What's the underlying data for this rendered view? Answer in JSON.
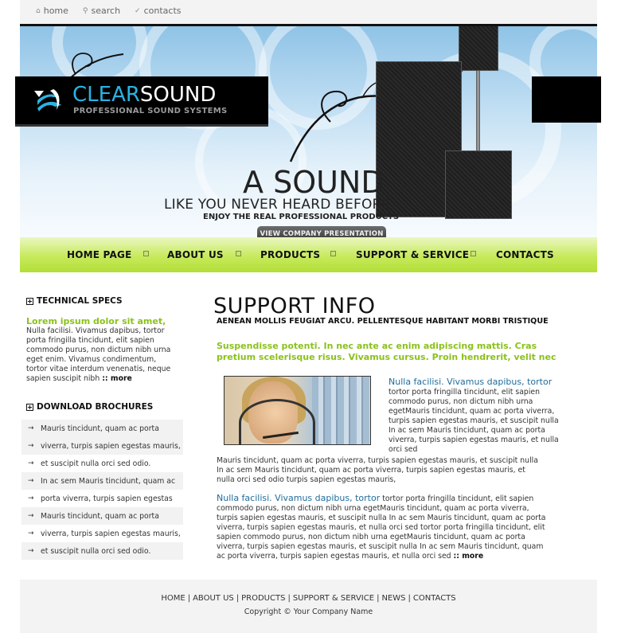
{
  "topnav": [
    {
      "label": "home",
      "icon": "house-icon"
    },
    {
      "label": "search",
      "icon": "magnifier-icon"
    },
    {
      "label": "contacts",
      "icon": "pencil-icon"
    }
  ],
  "logo": {
    "part1": "CLEAR",
    "part2": "SOUND",
    "subtitle": "PROFESSIONAL SOUND SYSTEMS"
  },
  "hero": {
    "line1": "A SOUND",
    "line2": "LIKE YOU NEVER HEARD BEFORE",
    "line3": "ENJOY THE REAL PROFESSIONAL PRODUCTS",
    "button": "VIEW COMPANY PRESENTATION"
  },
  "nav": [
    "HOME PAGE",
    "ABOUT US",
    "PRODUCTS",
    "SUPPORT & SERVICE",
    "CONTACTS"
  ],
  "left": {
    "specs_title": "TECHNICAL SPECS",
    "specs_lead": "Lorem ipsum dolor sit amet,",
    "specs_text": "Nulla facilisi. Vivamus dapibus, tortor porta fringilla tincidunt, elit sapien commodo purus, non dictum nibh urna eget enim. Vivamus condimentum, tortor vitae interdum venenatis, neque sapien suscipit nibh",
    "more": ":: more",
    "downloads_title": "DOWNLOAD BROCHURES",
    "downloads": [
      "Mauris tincidunt, quam ac porta",
      "viverra, turpis sapien egestas mauris,",
      "et suscipit nulla orci sed odio.",
      "In ac sem Mauris tincidunt, quam ac",
      "porta viverra, turpis sapien egestas",
      "Mauris tincidunt, quam ac porta",
      "viverra, turpis sapien egestas mauris,",
      "et suscipit nulla orci sed odio."
    ]
  },
  "main": {
    "title": "SUPPORT INFO",
    "subtitle": "AENEAN MOLLIS FEUGIAT ARCU. PELLENTESQUE HABITANT MORBI TRISTIQUE",
    "green": "Suspendisse potenti. In nec ante ac enim adipiscing mattis. Cras pretium scelerisque risus. Vivamus cursus. Proin hendrerit, velit nec",
    "block1_heading": "Nulla facilisi. Vivamus dapibus, tortor",
    "block1_text": "tortor porta fringilla tincidunt, elit sapien commodo purus, non dictum nibh urna egetMauris tincidunt, quam ac porta viverra, turpis sapien egestas mauris, et suscipit nulla In ac sem Mauris tincidunt, quam ac porta viverra, turpis sapien egestas mauris, et nulla orci sed",
    "para2": "Mauris tincidunt, quam ac porta viverra, turpis sapien egestas mauris, et suscipit nulla In ac sem Mauris tincidunt, quam ac porta viverra, turpis sapien egestas mauris, et nulla orci sed odio turpis sapien egestas mauris,",
    "block2_heading": "Nulla facilisi. Vivamus dapibus, tortor",
    "block2_text_first": "tortor porta fringilla tincidunt, elit sapien",
    "block2_text": "commodo purus, non dictum nibh urna egetMauris tincidunt, quam ac porta viverra, turpis sapien egestas mauris, et suscipit nulla In ac sem Mauris tincidunt, quam ac porta viverra, turpis sapien egestas mauris, et nulla orci sed tortor porta fringilla tincidunt, elit sapien commodo purus, non dictum nibh urna egetMauris tincidunt, quam ac porta viverra, turpis sapien egestas mauris, et suscipit nulla In ac sem Mauris tincidunt, quam ac porta viverra, turpis sapien egestas mauris, et nulla orci sed",
    "more": ":: more"
  },
  "footer": {
    "links": [
      "HOME",
      "ABOUT US",
      "PRODUCTS",
      "SUPPORT & SERVICE",
      "NEWS",
      "CONTACTS"
    ],
    "copyright": "Copyright © Your Company Name"
  },
  "colors": {
    "accent_green": "#8ac21a",
    "accent_blue": "#29b3e3",
    "heading_blue": "#1f6c9c"
  }
}
